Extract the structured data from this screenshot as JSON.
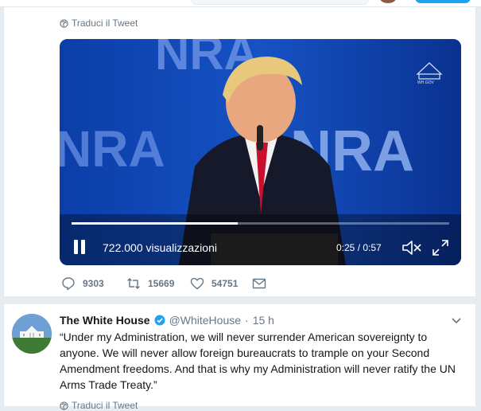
{
  "tweet1": {
    "translate_label": "Traduci il Tweet",
    "video": {
      "views": "722.000 visualizzazioni",
      "time": "0:25 / 0:57",
      "progress": 0.44,
      "banner_text": "NRA",
      "watermark": "WH.GOV"
    },
    "actions": {
      "replies": "9303",
      "retweets": "15669",
      "likes": "54751"
    }
  },
  "tweet2": {
    "name": "The White House",
    "handle": "@WhiteHouse",
    "separator": "·",
    "time": "15 h",
    "text": "“Under my Administration, we will never surrender American sovereignty to anyone. We will never allow foreign bureaucrats to trample on your Second Amendment freedoms. And that is why my Administration will never ratify the UN Arms Trade Treaty.”",
    "translate_label": "Traduci il Tweet"
  },
  "colors": {
    "accent": "#1da1f2",
    "muted": "#657786",
    "background": "#e6ecf0"
  }
}
